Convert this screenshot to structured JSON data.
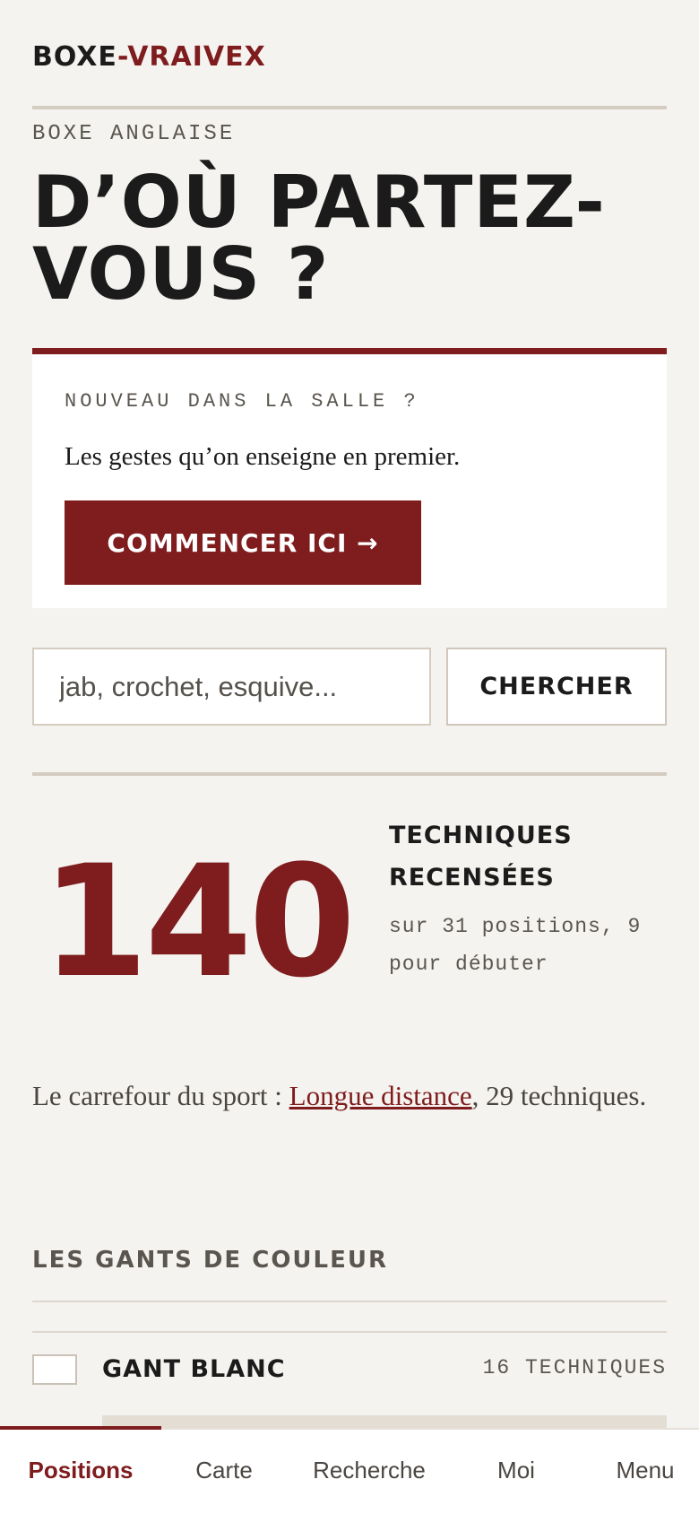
{
  "brand": {
    "part1": "BOXE",
    "separator": "-",
    "part2": "VRAIVEX",
    "accent_color": "#7e1c1e"
  },
  "hero": {
    "kicker": "BOXE ANGLAISE",
    "title": "D’OÙ PARTEZ-VOUS ?"
  },
  "starter_card": {
    "kicker": "NOUVEAU DANS LA SALLE ?",
    "text": "Les gestes qu’on enseigne en premier.",
    "button_label": "COMMENCER ICI →"
  },
  "search": {
    "placeholder": "jab, crochet, esquive...",
    "value": "",
    "button_label": "CHERCHER"
  },
  "stats": {
    "count": "140",
    "title": "TECHNIQUES RECENSÉES",
    "subtitle": "sur 31 positions, 9 pour débuter"
  },
  "crossroad": {
    "prefix": "Le carrefour du sport : ",
    "link_label": "Longue distance",
    "suffix": ", 29 techniques."
  },
  "gloves": {
    "section_title": "LES GANTS DE COULEUR",
    "items": [
      {
        "name": "GANT BLANC",
        "count_label": "16 TECHNIQUES",
        "swatch_color": "#ffffff"
      }
    ]
  },
  "bottom_nav": {
    "items": [
      {
        "label": "Positions",
        "active": true
      },
      {
        "label": "Carte",
        "active": false
      },
      {
        "label": "Recherche",
        "active": false
      },
      {
        "label": "Moi",
        "active": false
      },
      {
        "label": "Menu",
        "active": false
      }
    ]
  }
}
